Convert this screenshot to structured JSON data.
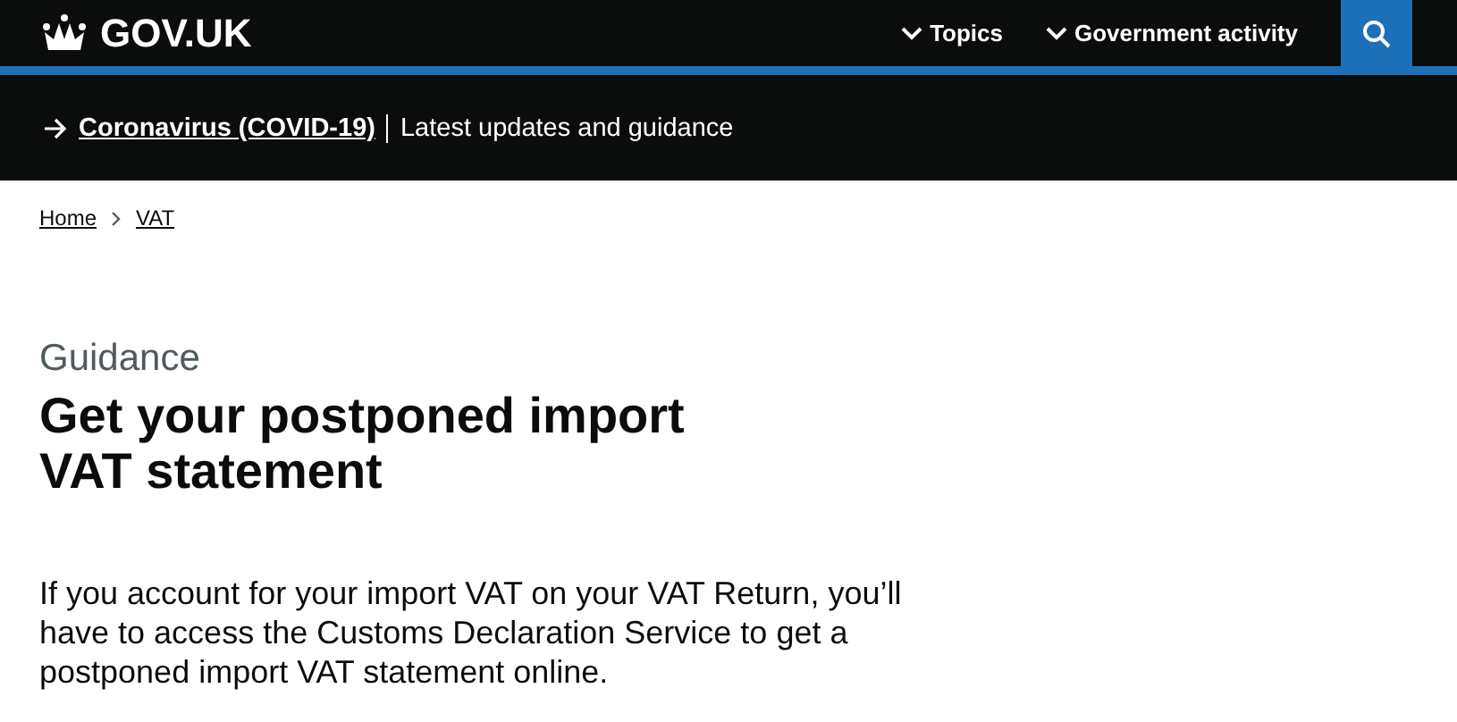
{
  "header": {
    "logo": "GOV.UK",
    "nav": [
      {
        "label": "Topics"
      },
      {
        "label": "Government activity"
      }
    ]
  },
  "banner": {
    "link": "Coronavirus (COVID-19)",
    "text": "Latest updates and guidance"
  },
  "breadcrumbs": [
    "Home",
    "VAT"
  ],
  "caption": "Guidance",
  "title": "Get your postponed import VAT statement",
  "lead": "If you account for your import VAT on your VAT Return, you’ll have to access the Customs Declaration Service to get a postponed import VAT statement online."
}
